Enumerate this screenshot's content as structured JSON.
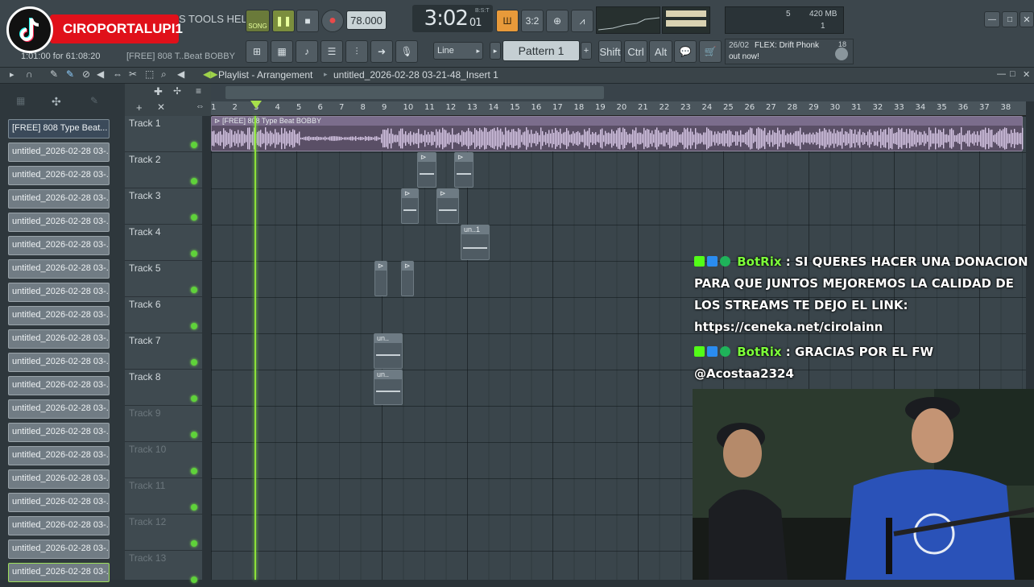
{
  "overlay": {
    "channel_name": "CIROPORTALUPI1",
    "tiktok_icon": "tiktok-icon"
  },
  "topbar": {
    "menu_fragment": "S TOOLS HELP",
    "song_label": "SONG",
    "tempo": "78.000",
    "time_main": "3:02",
    "time_sub": "01",
    "time_mode": "B:S:T",
    "time_hint": "1:01:00 for 61:08:20",
    "hint_file": "[FREE] 808 T..Beat BOBBY",
    "cpu_num": "5",
    "memory": "420 MB",
    "poly": "1",
    "snap_label": "Line",
    "pattern_label": "Pattern 1",
    "shift_label": "Shift",
    "ctrl_label": "Ctrl",
    "alt_label": "Alt",
    "news_date": "26/02",
    "news_text": "FLEX: Drift Phonk",
    "news_text2": "out now!",
    "news_count": "18"
  },
  "playlist": {
    "title": "Playlist - Arrangement",
    "breadcrumb": "untitled_2026-02-28 03-21-48_Insert 1",
    "audio_clip_label": "[FREE] 808 Type Beat BOBBY",
    "bars": [
      "1",
      "2",
      "3",
      "4",
      "5",
      "6",
      "7",
      "8",
      "9",
      "10",
      "11",
      "12",
      "13",
      "14",
      "15",
      "16",
      "17",
      "18",
      "19",
      "20",
      "21",
      "22",
      "23",
      "24",
      "25",
      "26",
      "27",
      "28",
      "29",
      "30",
      "31",
      "32",
      "33",
      "34",
      "35",
      "36",
      "37",
      "38"
    ],
    "tracks": [
      {
        "name": "Track 1",
        "active": true
      },
      {
        "name": "Track 2",
        "active": true
      },
      {
        "name": "Track 3",
        "active": true
      },
      {
        "name": "Track 4",
        "active": true
      },
      {
        "name": "Track 5",
        "active": true
      },
      {
        "name": "Track 6",
        "active": true
      },
      {
        "name": "Track 7",
        "active": true
      },
      {
        "name": "Track 8",
        "active": true
      },
      {
        "name": "Track 9",
        "active": false
      },
      {
        "name": "Track 10",
        "active": false
      },
      {
        "name": "Track 11",
        "active": false
      },
      {
        "name": "Track 12",
        "active": false
      },
      {
        "name": "Track 13",
        "active": false
      }
    ],
    "clips": [
      {
        "label": "un..1"
      },
      {
        "label": "un.."
      },
      {
        "label": "un.."
      }
    ]
  },
  "browser": {
    "items": [
      "[FREE] 808 Type Beat...",
      "untitled_2026-02-28 03-...",
      "untitled_2026-02-28 03-...",
      "untitled_2026-02-28 03-...",
      "untitled_2026-02-28 03-...",
      "untitled_2026-02-28 03-...",
      "untitled_2026-02-28 03-...",
      "untitled_2026-02-28 03-...",
      "untitled_2026-02-28 03-...",
      "untitled_2026-02-28 03-...",
      "untitled_2026-02-28 03-...",
      "untitled_2026-02-28 03-...",
      "untitled_2026-02-28 03-...",
      "untitled_2026-02-28 03-...",
      "untitled_2026-02-28 03-...",
      "untitled_2026-02-28 03-...",
      "untitled_2026-02-28 03-...",
      "untitled_2026-02-28 03-...",
      "untitled_2026-02-28 03-...",
      "untitled_2026-02-28 03-..."
    ]
  },
  "chat": {
    "messages": [
      {
        "user": "BotRix",
        "text": "SI QUERES HACER UNA DONACION PARA QUE JUNTOS MEJOREMOS LA CALIDAD DE LOS STREAMS TE DEJO EL LINK: https://ceneka.net/cirolainn"
      },
      {
        "user": "BotRix",
        "text": "GRACIAS POR EL FW @Acostaa2324"
      }
    ]
  },
  "colors": {
    "accent_green": "#7ef04d",
    "channel_red": "#e0101a",
    "grid_bg": "#3a454b"
  }
}
